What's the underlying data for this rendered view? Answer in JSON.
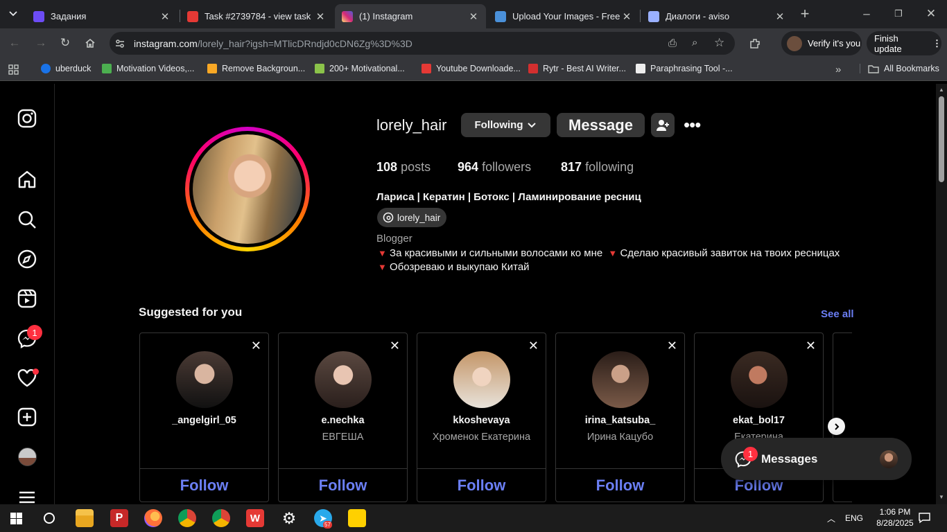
{
  "browser": {
    "tabs": [
      {
        "title": "Задания",
        "favicon_color": "#6c4cf5"
      },
      {
        "title": "Task #2739784 - view task",
        "favicon_color": "#e53935"
      },
      {
        "title": "(1) Instagram",
        "favicon_color": "#e1306c"
      },
      {
        "title": "Upload Your Images - Free I",
        "favicon_color": "#4a90d9"
      },
      {
        "title": "Диалоги - aviso",
        "favicon_color": "#9ab0ff"
      }
    ],
    "url_host": "instagram.com",
    "url_path": "/lorely_hair?igsh=MTlicDRndjd0cDN6Zg%3D%3D",
    "profile_button": "Verify it's you",
    "update_button": "Finish update",
    "bookmarks": [
      {
        "label": "uberduck",
        "color": "#1a73e8"
      },
      {
        "label": "Motivation Videos,...",
        "color": "#4caf50"
      },
      {
        "label": "Remove Backgroun...",
        "color": "#f9a825"
      },
      {
        "label": "200+ Motivational...",
        "color": "#8bc34a"
      },
      {
        "label": "Youtube Downloade...",
        "color": "#e53935"
      },
      {
        "label": "Rytr - Best AI Writer...",
        "color": "#d32f2f"
      },
      {
        "label": "Paraphrasing Tool -...",
        "color": "#eeeeee"
      }
    ],
    "all_bookmarks": "All Bookmarks"
  },
  "sidebar": {
    "messages_badge": "1"
  },
  "profile": {
    "username": "lorely_hair",
    "following_button": "Following",
    "message_button": "Message",
    "posts_count": "108",
    "posts_label": "posts",
    "followers_count": "964",
    "followers_label": "followers",
    "following_count": "817",
    "following_label": "following",
    "full_name": "Лариса | Кератин | Ботокс | Ламинирование ресниц",
    "threads_handle": "lorely_hair",
    "category": "Blogger",
    "bio_line1_a": "За красивыми и сильными волосами ко мне",
    "bio_line1_b": "Сделаю красивый завиток на твоих ресницах",
    "bio_line2": "Обозреваю и выкупаю Китай"
  },
  "suggested": {
    "title": "Suggested for you",
    "see_all": "See all",
    "follow_label": "Follow",
    "cards": [
      {
        "username": "_angelgirl_05",
        "name": "",
        "color": "#3a3030"
      },
      {
        "username": "e.nechka",
        "name": "ЕВГЕША",
        "color": "#6a5048"
      },
      {
        "username": "kkoshevaya",
        "name": "Хроменок Екатерина",
        "color": "#b08a6a"
      },
      {
        "username": "irina_katsuba_",
        "name": "Ирина Кацубо",
        "color": "#3b2a22"
      },
      {
        "username": "ekat_bol17",
        "name": "Екатерина",
        "color": "#4a3028"
      }
    ]
  },
  "messages_panel": {
    "label": "Messages",
    "badge": "1"
  },
  "taskbar": {
    "language": "ENG",
    "time": "1:06 PM",
    "date": "8/28/2025",
    "telegram_badge": "57"
  }
}
